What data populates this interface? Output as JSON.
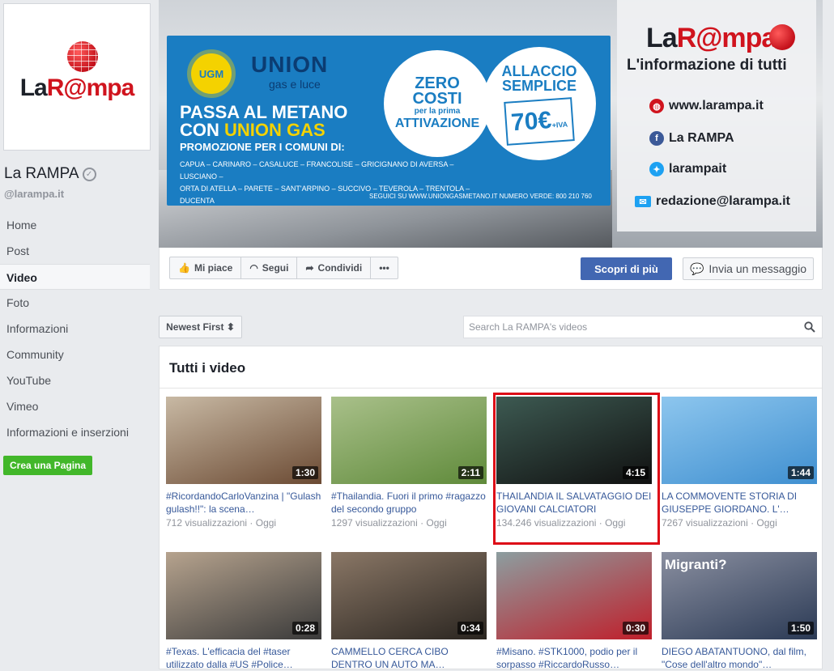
{
  "page": {
    "name": "La RAMPA",
    "handle": "@larampa.it",
    "logo": {
      "prefix": "La",
      "middle": "R@",
      "suffix": "mpa"
    }
  },
  "nav": [
    {
      "label": "Home",
      "active": false
    },
    {
      "label": "Post",
      "active": false
    },
    {
      "label": "Video",
      "active": true
    },
    {
      "label": "Foto",
      "active": false
    },
    {
      "label": "Informazioni",
      "active": false
    },
    {
      "label": "Community",
      "active": false
    },
    {
      "label": "YouTube",
      "active": false
    },
    {
      "label": "Vimeo",
      "active": false
    },
    {
      "label": "Informazioni e inserzioni",
      "active": false
    }
  ],
  "create_page_label": "Crea una Pagina",
  "cover": {
    "ad": {
      "ugm": "UGM",
      "brand": "UNION",
      "brand_sub": "gas e luce",
      "headline_1": "PASSA AL METANO",
      "headline_2_prefix": "CON",
      "headline_2_highlight": "UNION GAS",
      "promo": "PROMOZIONE PER I COMUNI DI:",
      "comuni_1": "CAPUA – CARINARO – CASALUCE – FRANCOLISE – GRICIGNANO DI AVERSA – LUSCIANO –",
      "comuni_2": "ORTA DI ATELLA – PARETE – SANT'ARPINO – SUCCIVO – TEVEROLA – TRENTOLA – DUCENTA",
      "seguici": "SEGUICI SU   WWW.UNIONGASMETANO.IT   NUMERO VERDE: 800 210 760",
      "zero_1": "ZERO",
      "zero_2": "COSTI",
      "zero_3": "per la prima",
      "zero_4": "ATTIVAZIONE",
      "allaccio_1": "ALLACCIO",
      "allaccio_2": "SEMPLICE",
      "price": "70€",
      "price_suffix": "+IVA"
    },
    "card": {
      "logo_prefix": "La",
      "logo_red": "R@mpa",
      "tagline": "L'informazione di tutti",
      "website": "www.larampa.it",
      "facebook": "La RAMPA",
      "twitter": "larampait",
      "email": "redazione@larampa.it"
    }
  },
  "actions": {
    "like": "Mi piace",
    "follow": "Segui",
    "share": "Condividi",
    "more": "•••",
    "discover": "Scopri di più",
    "message": "Invia un messaggio"
  },
  "sort_label": "Newest First ⬍",
  "search": {
    "placeholder": "Search La RAMPA's videos"
  },
  "videos_title": "Tutti i video",
  "videos": [
    {
      "duration": "1:30",
      "title": "#RicordandoCarloVanzina | \"Gulash gulash!!\": la scena…",
      "views": "712 visualizzazioni",
      "date": "Oggi",
      "c1": "#6b4a33",
      "c2": "#c8b9a4",
      "highlight": false
    },
    {
      "duration": "2:11",
      "title": "#Thailandia. Fuori il primo #ragazzo del secondo gruppo",
      "views": "1297 visualizzazioni",
      "date": "Oggi",
      "c1": "#5f8a3a",
      "c2": "#a9c08a",
      "highlight": false
    },
    {
      "duration": "4:15",
      "title": "THAILANDIA IL SALVATAGGIO DEI GIOVANI CALCIATORI",
      "views": "134.246 visualizzazioni",
      "date": "Oggi",
      "c1": "#101010",
      "c2": "#3d5a52",
      "highlight": true
    },
    {
      "duration": "1:44",
      "title": "LA COMMOVENTE STORIA DI GIUSEPPE GIORDANO. L'…",
      "views": "7267 visualizzazioni",
      "date": "Oggi",
      "c1": "#3f8fd0",
      "c2": "#8dc6ee",
      "highlight": false
    },
    {
      "duration": "0:28",
      "title": "#Texas. L'efficacia del #taser utilizzato dalla #US #Police…",
      "views": "",
      "date": "",
      "c1": "#3a3a3a",
      "c2": "#b6a38e",
      "highlight": false
    },
    {
      "duration": "0:34",
      "title": "CAMMELLO CERCA CIBO DENTRO UN AUTO MA…",
      "views": "",
      "date": "",
      "c1": "#2a2520",
      "c2": "#8a7766",
      "highlight": false
    },
    {
      "duration": "0:30",
      "title": "#Misano. #STK1000, podio per il sorpasso #RiccardoRusso…",
      "views": "",
      "date": "",
      "c1": "#c01e2a",
      "c2": "#8c9ea0",
      "highlight": false
    },
    {
      "duration": "1:50",
      "title": "DIEGO ABATANTUONO, dal film, \"Cose dell'altro mondo\"…",
      "views": "",
      "date": "",
      "c1": "#2b3a55",
      "c2": "#8a8fa0",
      "highlight": false,
      "overlay": "Migranti?"
    }
  ]
}
